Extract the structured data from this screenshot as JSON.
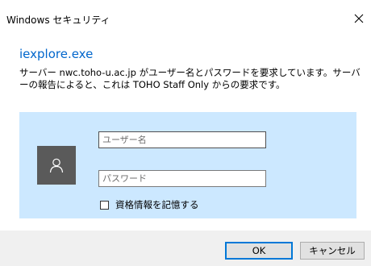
{
  "window": {
    "title": "Windows セキュリティ",
    "close_glyph": "✕"
  },
  "app": {
    "name": "iexplore.exe"
  },
  "message": {
    "text": "サーバー nwc.toho-u.ac.jp がユーザー名とパスワードを要求しています。サーバーの報告によると、これは TOHO Staff Only からの要求です。"
  },
  "credentials": {
    "avatar_icon": "user-icon",
    "username": {
      "value": "",
      "placeholder": "ユーザー名"
    },
    "password": {
      "value": "",
      "placeholder": "パスワード"
    },
    "remember": {
      "label": "資格情報を記憶する",
      "checked": false
    }
  },
  "buttons": {
    "ok_label": "OK",
    "cancel_label": "キャンセル"
  },
  "colors": {
    "accent": "#0078d7",
    "app_name": "#0066cc",
    "panel_background": "#cce8ff",
    "avatar_background": "#5a5a5a",
    "footer_background": "#f0f0f0"
  }
}
